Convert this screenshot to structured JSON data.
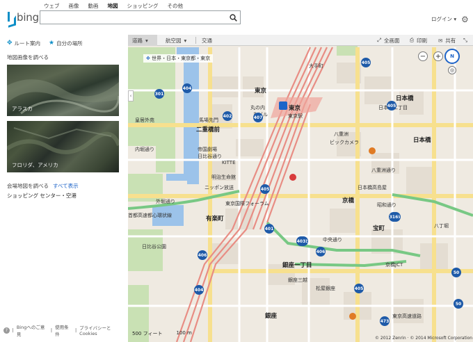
{
  "header": {
    "logo_text": "bing",
    "scopes": [
      "ウェブ",
      "画像",
      "動画",
      "地図",
      "ショッピング",
      "その他"
    ],
    "active_scope": "地図",
    "search_value": "",
    "login_label": "ログイン",
    "login_caret": "▾"
  },
  "left": {
    "route_label": "ルート案内",
    "myplaces_label": "自分の場所",
    "section_title": "地図画像を調べる",
    "aerials": [
      {
        "caption": "アラスカ"
      },
      {
        "caption": "フロリダ、アメリカ"
      }
    ],
    "venue_title": "会場地図を調べる",
    "venue_more": "すべて表示",
    "venue_item": "ショッピング センター・空港",
    "footer": [
      "Bingへのご意見",
      "使用条件",
      "プライバシーと Cookies"
    ]
  },
  "map": {
    "toolbar": {
      "road": "道路",
      "road_caret": "▾",
      "aerial": "航空図",
      "aerial_caret": "▾",
      "traffic": "交通",
      "fullscreen": "全画面",
      "print": "印刷",
      "share": "共有"
    },
    "breadcrumb": "世界・日本・東京都・東京",
    "compass": "N",
    "scale_feet": "500 フィート",
    "scale_m": "100 m",
    "copyright": "© 2012 Zenrin · © 2014 Microsoft Corporation",
    "labels": [
      {
        "t": "東京",
        "c": "big"
      },
      {
        "t": "東京",
        "c": "big"
      },
      {
        "t": "日本橋",
        "c": "big"
      },
      {
        "t": "日本橋",
        "c": "big"
      },
      {
        "t": "二重橋前",
        "c": "big"
      },
      {
        "t": "有楽町",
        "c": "big"
      },
      {
        "t": "京橋",
        "c": "big"
      },
      {
        "t": "宝町",
        "c": "big"
      },
      {
        "t": "銀座一丁目",
        "c": "big"
      },
      {
        "t": "銀座",
        "c": "big"
      },
      {
        "t": "丸の内",
        "c": ""
      },
      {
        "t": "八重洲",
        "c": ""
      },
      {
        "t": "馬場先門",
        "c": ""
      },
      {
        "t": "皇居外苑",
        "c": ""
      },
      {
        "t": "日比谷公園",
        "c": ""
      },
      {
        "t": "大手町",
        "c": ""
      },
      {
        "t": "京橋JCT",
        "c": ""
      },
      {
        "t": "KITTE",
        "c": ""
      },
      {
        "t": "東京国際フォーラム",
        "c": ""
      },
      {
        "t": "ビックカメラ",
        "c": ""
      },
      {
        "t": "日本橋高島屋",
        "c": ""
      },
      {
        "t": "東京駅",
        "c": ""
      },
      {
        "t": "丸ビル",
        "c": ""
      },
      {
        "t": "内堀通り",
        "c": ""
      },
      {
        "t": "日比谷通り",
        "c": ""
      },
      {
        "t": "八重洲通り",
        "c": ""
      },
      {
        "t": "中央通り",
        "c": ""
      },
      {
        "t": "昭和通り",
        "c": ""
      },
      {
        "t": "外堀通り",
        "c": ""
      },
      {
        "t": "首都高速都心環状線",
        "c": ""
      },
      {
        "t": "日本橋二丁目",
        "c": ""
      },
      {
        "t": "八丁堀",
        "c": ""
      },
      {
        "t": "ニッポン放送",
        "c": ""
      },
      {
        "t": "帝国劇場",
        "c": ""
      },
      {
        "t": "明治生命館",
        "c": ""
      },
      {
        "t": "銀座三越",
        "c": ""
      },
      {
        "t": "松屋銀座",
        "c": ""
      },
      {
        "t": "東京高速道路",
        "c": ""
      }
    ],
    "shields": [
      "405",
      "404",
      "301",
      "407",
      "402",
      "406",
      "405",
      "316",
      "401",
      "402",
      "405",
      "473",
      "50",
      "316",
      "403",
      "406",
      "404",
      "405",
      "50"
    ],
    "colors": {
      "water": "#9cc3ea",
      "park": "#c9e1b4",
      "rail": "#e88d84",
      "road_yellow": "#f7e08e",
      "expressway": "#78c884",
      "route_shield": "#1e5aa8"
    }
  }
}
